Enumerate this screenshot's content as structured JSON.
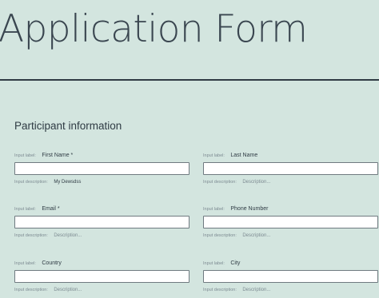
{
  "form": {
    "title": "Application Form",
    "section_title": "Participant information"
  },
  "fields": [
    {
      "id": "first-name",
      "input_meta": "Input label:",
      "label": "First Name *",
      "value": "",
      "description_meta": "Input description:",
      "description": "My Dewsdss",
      "description_is_placeholder": false
    },
    {
      "id": "last-name",
      "input_meta": "Input label:",
      "label": "Last Name",
      "value": "",
      "description_meta": "Input description:",
      "description": "Description...",
      "description_is_placeholder": true
    },
    {
      "id": "email",
      "input_meta": "Input label:",
      "label": "Email *",
      "value": "",
      "description_meta": "Input description:",
      "description": "Description...",
      "description_is_placeholder": true
    },
    {
      "id": "phone-number",
      "input_meta": "Input label:",
      "label": "Phone Number",
      "value": "",
      "description_meta": "Input description:",
      "description": "Description...",
      "description_is_placeholder": true
    },
    {
      "id": "country",
      "input_meta": "Input label:",
      "label": "Country",
      "value": "",
      "description_meta": "Input description:",
      "description": "Description...",
      "description_is_placeholder": true
    },
    {
      "id": "city",
      "input_meta": "Input label:",
      "label": "City",
      "value": "",
      "description_meta": "Input description:",
      "description": "Description...",
      "description_is_placeholder": true
    }
  ],
  "colors": {
    "background": "#d3e5df",
    "text": "#2f3b44",
    "muted_text": "#7d8b92",
    "input_border": "#6f7a80"
  }
}
